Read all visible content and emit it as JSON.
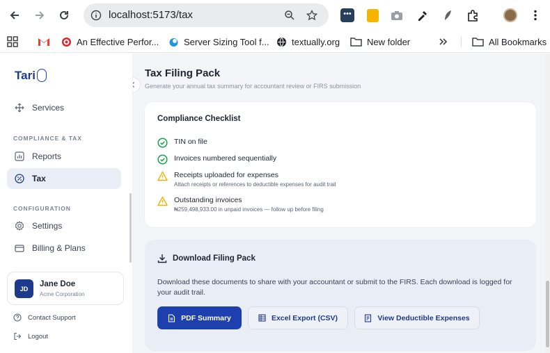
{
  "browser": {
    "url": "localhost:5173/tax",
    "bookmarks": [
      {
        "label": "An Effective Perfor..."
      },
      {
        "label": "Server Sizing Tool f..."
      },
      {
        "label": "textually.org"
      },
      {
        "label": "New folder"
      },
      {
        "label": "All Bookmarks"
      }
    ]
  },
  "sidebar": {
    "logo": "Tari",
    "items": {
      "services": "Services",
      "reports": "Reports",
      "tax": "Tax",
      "settings": "Settings",
      "billing": "Billing & Plans"
    },
    "sections": {
      "compliance": "COMPLIANCE & TAX",
      "configuration": "CONFIGURATION"
    },
    "user": {
      "initials": "JD",
      "name": "Jane Doe",
      "org": "Acme Corporation"
    },
    "footer": {
      "support": "Contact Support",
      "logout": "Logout"
    }
  },
  "header": {
    "title": "Tax Filing Pack",
    "subtitle": "Generate your annual tax summary for accountant review or FIRS submission"
  },
  "checklist": {
    "title": "Compliance Checklist",
    "items": [
      {
        "status": "done",
        "label": "TIN on file",
        "detail": ""
      },
      {
        "status": "done",
        "label": "Invoices numbered sequentially",
        "detail": ""
      },
      {
        "status": "warning",
        "label": "Receipts uploaded for expenses",
        "detail": "Attach receipts or references to deductible expenses for audit trail"
      },
      {
        "status": "warning",
        "label": "Outstanding invoices",
        "detail": "₦259,498,933.00 in unpaid invoices — follow up before filing"
      }
    ]
  },
  "download": {
    "title": "Download Filing Pack",
    "description": "Download these documents to share with your accountant or submit to the FIRS. Each download is logged for your audit trail.",
    "buttons": {
      "pdf": "PDF Summary",
      "excel": "Excel Export (CSV)",
      "deductible": "View Deductible Expenses"
    }
  },
  "colors": {
    "primary": "#1e40af",
    "success": "#16a34a",
    "warning": "#eab308"
  }
}
